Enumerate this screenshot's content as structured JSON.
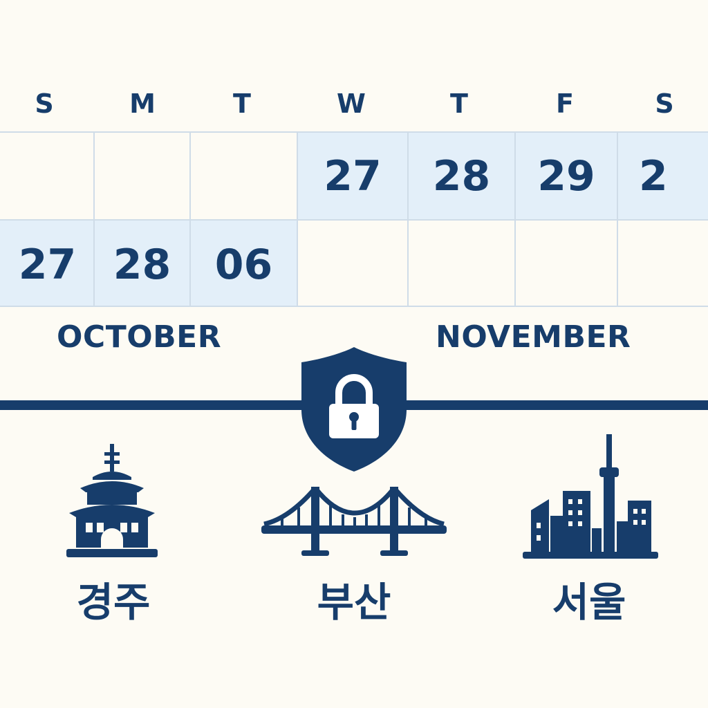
{
  "weekdays": [
    "S",
    "M",
    "T",
    "W",
    "T",
    "F",
    "S"
  ],
  "calendar": {
    "row1": [
      "",
      "",
      "",
      "27",
      "28",
      "29",
      "2"
    ],
    "row2": [
      "27",
      "28",
      "06",
      "",
      "",
      "",
      ""
    ]
  },
  "months": {
    "left": "OCTOBER",
    "right": "NOVEMBER"
  },
  "icons": {
    "timeline_center": "shield-lock-icon",
    "gyeongju": "pagoda-icon",
    "busan": "suspension-bridge-icon",
    "seoul": "city-skyline-tower-icon"
  },
  "cities": {
    "gyeongju": "경주",
    "busan": "부산",
    "seoul": "서울"
  },
  "colors": {
    "primary": "#173d6b",
    "highlight": "#e3eff9",
    "background": "#fdfbf4",
    "grid": "#cfdce8"
  }
}
